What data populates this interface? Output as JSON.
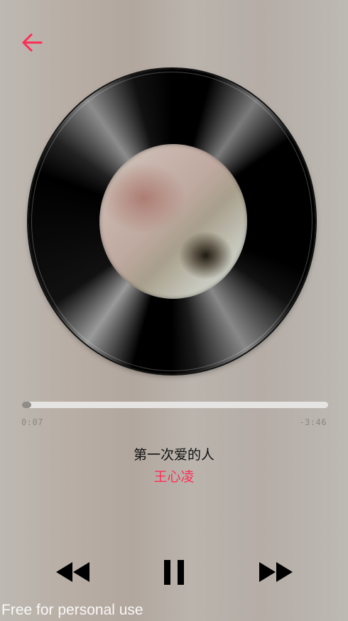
{
  "navigation": {
    "back_icon": "arrow-left-icon",
    "accent_color": "#ff2d55"
  },
  "player": {
    "elapsed": "0:07",
    "remaining": "-3:46",
    "progress": 0.03,
    "song_title": "第一次爱的人",
    "artist": "王心凌",
    "state": "playing"
  },
  "controls": {
    "rewind_icon": "rewind-icon",
    "pause_icon": "pause-icon",
    "forward_icon": "fast-forward-icon"
  },
  "watermark": "Free for personal use"
}
